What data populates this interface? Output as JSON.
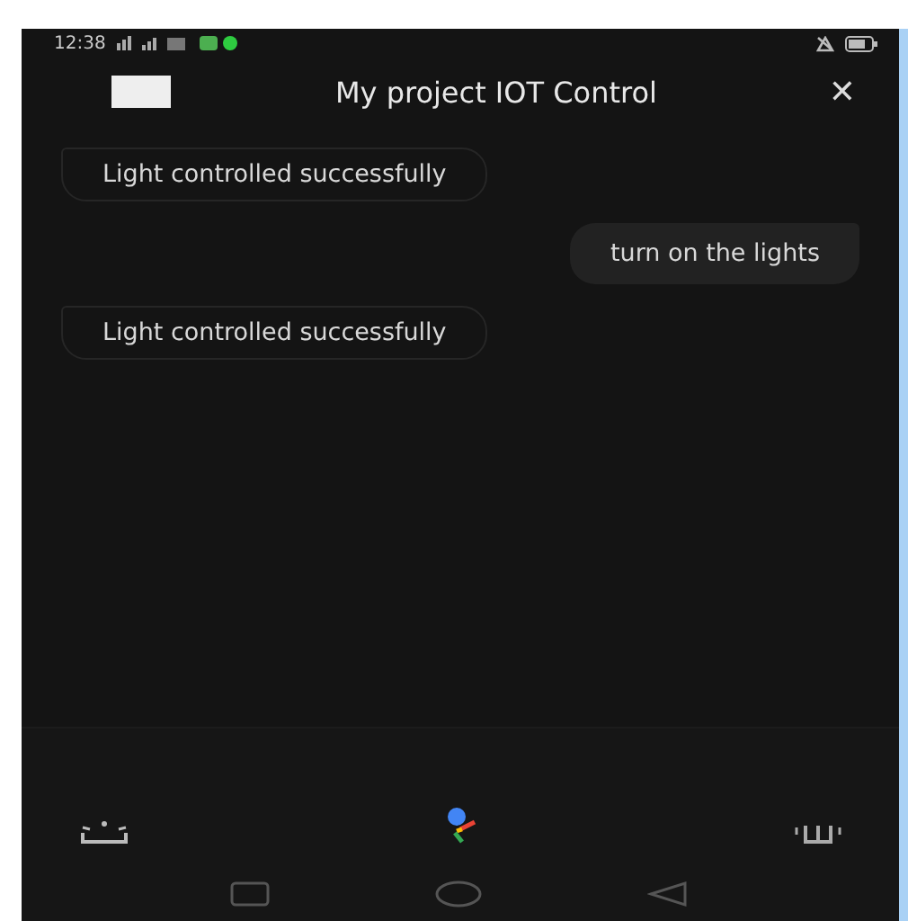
{
  "status_bar": {
    "time": "12:38"
  },
  "header": {
    "title": "My project IOT Control",
    "close": "✕"
  },
  "messages": [
    {
      "kind": "bot",
      "text": "Light controlled successfully"
    },
    {
      "kind": "user",
      "text": "turn on the lights"
    },
    {
      "kind": "bot",
      "text": "Light controlled successfully"
    }
  ]
}
